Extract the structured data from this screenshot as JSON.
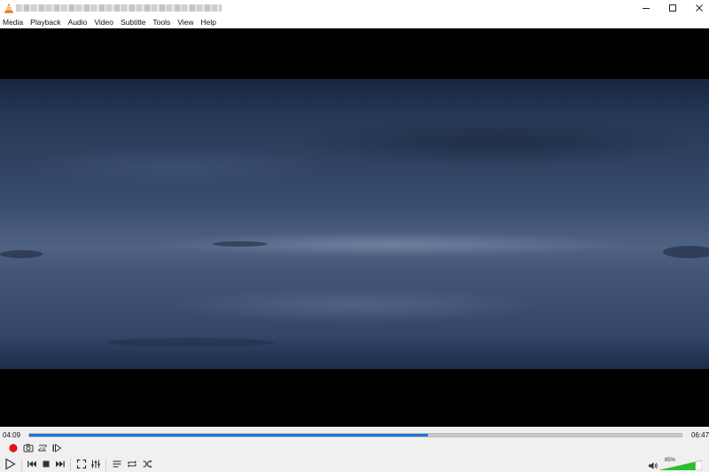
{
  "window": {
    "title": "",
    "accent_color": "#1e74d1"
  },
  "menu": {
    "items": [
      "Media",
      "Playback",
      "Audio",
      "Video",
      "Subtitle",
      "Tools",
      "View",
      "Help"
    ]
  },
  "playback": {
    "elapsed": "04:09",
    "total": "06:47",
    "progress": 0.612
  },
  "controls": {
    "row1": [
      "record-icon",
      "snapshot-icon",
      "loop-ab-icon",
      "frame-by-frame-icon"
    ],
    "row2": [
      "play-icon",
      "previous-icon",
      "stop-icon",
      "next-icon",
      "fullscreen-icon",
      "extended-settings-icon",
      "playlist-icon",
      "loop-icon",
      "shuffle-icon"
    ]
  },
  "volume": {
    "label": "85%",
    "level": 0.85,
    "color": "#2bbf2b"
  }
}
